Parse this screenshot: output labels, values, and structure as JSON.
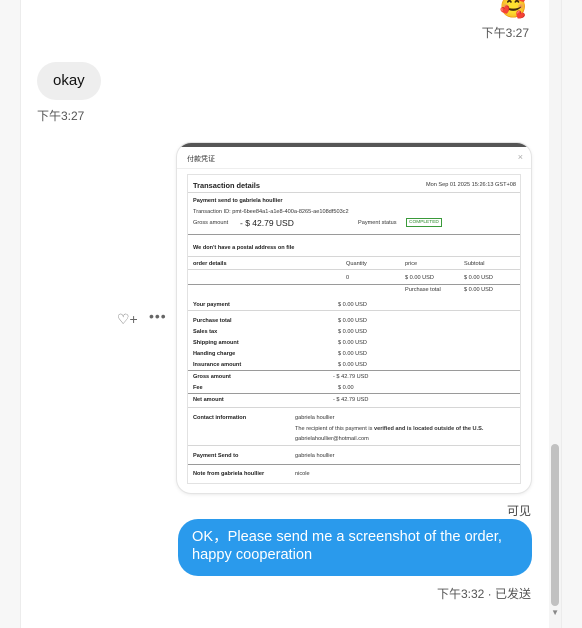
{
  "messages": {
    "top_emoji": "🥰",
    "top_time": "下午3:27",
    "incoming_text": "okay",
    "incoming_time": "下午3:27",
    "seen_label": "可见",
    "outgoing_text": "OK，Please send me a screenshot of the order, happy cooperation",
    "outgoing_time": "下午3:32 · 已发送"
  },
  "attachment": {
    "window_title": "付款凭证",
    "close_glyph": "×",
    "heading": "Transaction details",
    "datetime": "Mon Sep 01 2025 15:26:13 GST+08",
    "payment_send_to": "Payment send to gabriela houllier",
    "transaction_id": "Transaction ID: pmt-6bee84a1-a1e8-400a-8265-ae108df503c2",
    "gross_label": "Gross amount",
    "gross_value": "- $ 42.79 USD",
    "payment_status_label": "Payment status",
    "payment_status": "COMPLETED",
    "no_address": "We don't have a postal address on file",
    "order_details": "order details",
    "col_quantity": "Quantity",
    "col_price": "price",
    "col_subtotal": "Subtotal",
    "quantity_value": "0",
    "price_value": "$ 0.00 USD",
    "subtotal_value": "$ 0.00 USD",
    "purchase_total_label": "Purchase total",
    "purchase_total_value": "$ 0.00 USD",
    "summary": [
      {
        "label": "Your payment",
        "value": "$ 0.00 USD"
      },
      {
        "label": "Purchase total",
        "value": "$ 0.00 USD"
      },
      {
        "label": "Sales tax",
        "value": "$ 0.00 USD"
      },
      {
        "label": "Shipping amount",
        "value": "$ 0.00 USD"
      },
      {
        "label": "Handing charge",
        "value": "$ 0.00 USD"
      },
      {
        "label": "Insurance amount",
        "value": "$ 0.00 USD"
      },
      {
        "label": "Gross amount",
        "value": "- $ 42.79 USD"
      },
      {
        "label": "Fee",
        "value": "$ 0.00"
      },
      {
        "label": "Net amount",
        "value": "- $ 42.79 USD"
      }
    ],
    "contact_label": "Contact information",
    "contact_name": "gabriela houllier",
    "contact_note_pre": "The recipient of this payment is ",
    "contact_note_bold": "verified and is located outside of the U.S.",
    "contact_email": "gabrielahoullier@hotmail.com",
    "payment_send_to_label": "Payment Send to",
    "payment_send_to_value": "gabriela houllier",
    "note_label": "Note from gabriela houllier",
    "note_value": "nicole"
  },
  "actions": {
    "react_glyph": "♡+",
    "more_glyph": "•••"
  },
  "scrollbar": {
    "down_glyph": "▼"
  }
}
